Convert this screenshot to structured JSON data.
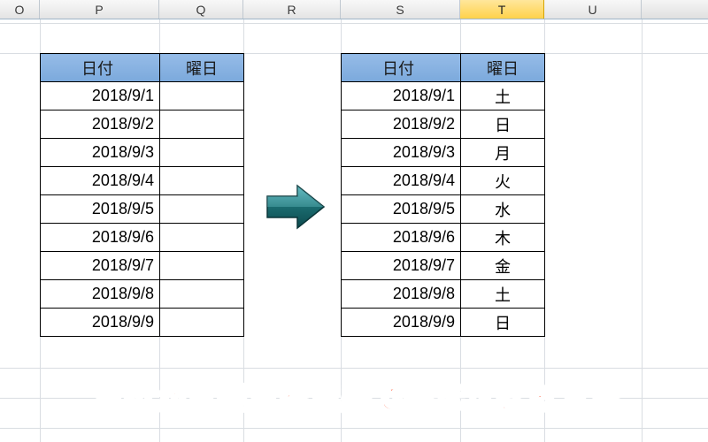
{
  "columns": [
    {
      "id": "O",
      "cls": "col-O",
      "active": false
    },
    {
      "id": "P",
      "cls": "col-P",
      "active": false
    },
    {
      "id": "Q",
      "cls": "col-Q",
      "active": false
    },
    {
      "id": "R",
      "cls": "col-R",
      "active": false
    },
    {
      "id": "S",
      "cls": "col-S",
      "active": false
    },
    {
      "id": "T",
      "cls": "col-T",
      "active": true
    },
    {
      "id": "U",
      "cls": "col-U",
      "active": false
    }
  ],
  "table_left": {
    "headers": {
      "date": "日付",
      "day": "曜日"
    },
    "rows": [
      {
        "date": "2018/9/1",
        "day": ""
      },
      {
        "date": "2018/9/2",
        "day": ""
      },
      {
        "date": "2018/9/3",
        "day": ""
      },
      {
        "date": "2018/9/4",
        "day": ""
      },
      {
        "date": "2018/9/5",
        "day": ""
      },
      {
        "date": "2018/9/6",
        "day": ""
      },
      {
        "date": "2018/9/7",
        "day": ""
      },
      {
        "date": "2018/9/8",
        "day": ""
      },
      {
        "date": "2018/9/9",
        "day": ""
      }
    ]
  },
  "table_right": {
    "headers": {
      "date": "日付",
      "day": "曜日"
    },
    "rows": [
      {
        "date": "2018/9/1",
        "day": "土"
      },
      {
        "date": "2018/9/2",
        "day": "日"
      },
      {
        "date": "2018/9/3",
        "day": "月"
      },
      {
        "date": "2018/9/4",
        "day": "火"
      },
      {
        "date": "2018/9/5",
        "day": "水"
      },
      {
        "date": "2018/9/6",
        "day": "木"
      },
      {
        "date": "2018/9/7",
        "day": "金"
      },
      {
        "date": "2018/9/8",
        "day": "土"
      },
      {
        "date": "2018/9/9",
        "day": "日"
      }
    ]
  },
  "caption": "日付から曜日を自動で表示させる方法",
  "arrow_colors": {
    "fill1": "#1a6b6f",
    "fill2": "#3a9aa0",
    "stroke": "#0d3d40"
  }
}
